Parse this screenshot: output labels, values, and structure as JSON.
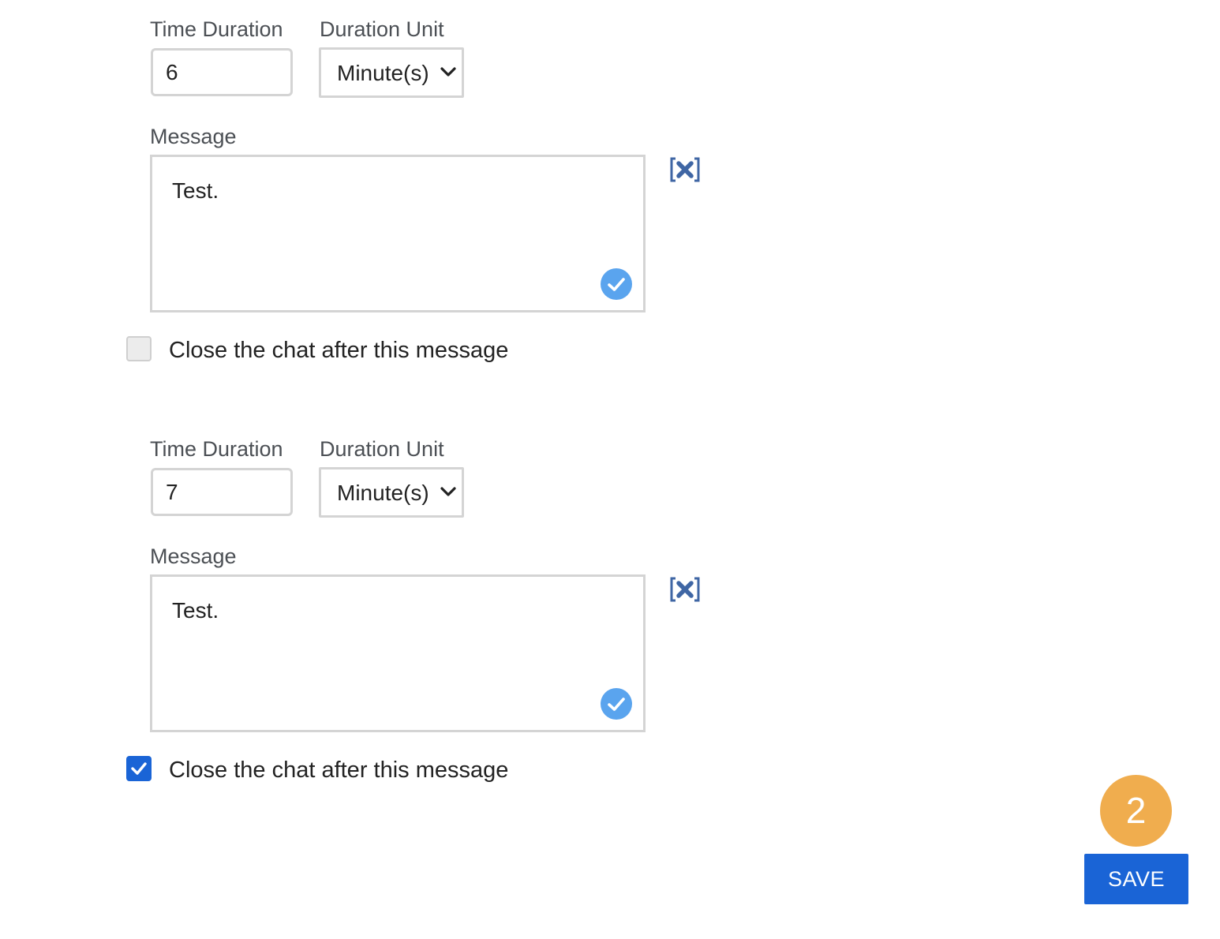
{
  "rules": [
    {
      "time_duration_label": "Time Duration",
      "time_duration_value": "6",
      "duration_unit_label": "Duration Unit",
      "duration_unit_value": "Minute(s)",
      "message_label": "Message",
      "message_value": "Test.",
      "close_chat_label": "Close the chat after this message",
      "close_chat_checked": false
    },
    {
      "time_duration_label": "Time Duration",
      "time_duration_value": "7",
      "duration_unit_label": "Duration Unit",
      "duration_unit_value": "Minute(s)",
      "message_label": "Message",
      "message_value": "Test.",
      "close_chat_label": "Close the chat after this message",
      "close_chat_checked": true
    }
  ],
  "step_badge": "2",
  "save_label": "SAVE",
  "icons": {
    "remove": "remove-x-icon",
    "valid": "check-circle-icon",
    "dropdown": "chevron-down-icon",
    "checkbox_check": "checkmark-icon"
  },
  "colors": {
    "primary": "#1a64d6",
    "badge": "#f0ad4e",
    "valid_check": "#5aa4ee",
    "remove_icon": "#3f66a4",
    "border": "#d4d4d4"
  }
}
